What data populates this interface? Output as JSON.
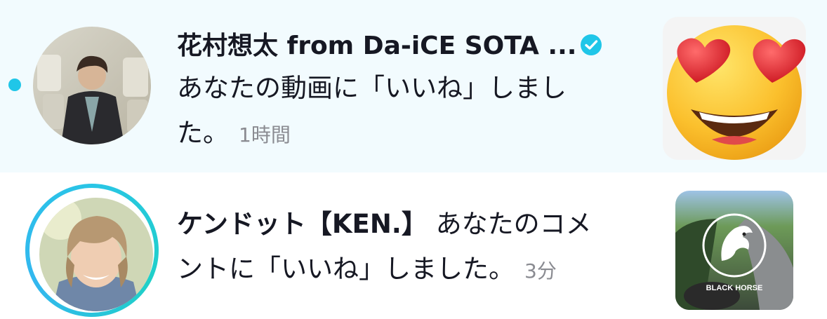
{
  "colors": {
    "accent": "#20c6e8",
    "unread_background": "#f2fbfe",
    "time_text": "#8a8b91"
  },
  "notifications": [
    {
      "name": "花村想太 from Da-iCE SOTA ...",
      "verified": true,
      "message_line1": "あなたの動画に「いいね」しまし",
      "message_line2": "た。",
      "time": "1時間",
      "unread": true,
      "thumbnail_icon": "heart-eyes-emoji-icon"
    },
    {
      "name": "ケンドット【KEN.】",
      "message_line1": " あなたのコメ",
      "message_line2": "ントに「いいね」しました。",
      "time": "3分",
      "has_story_ring": true,
      "thumbnail_text": "BLACK HORSE",
      "thumbnail_icon": "horse-logo-icon"
    }
  ]
}
